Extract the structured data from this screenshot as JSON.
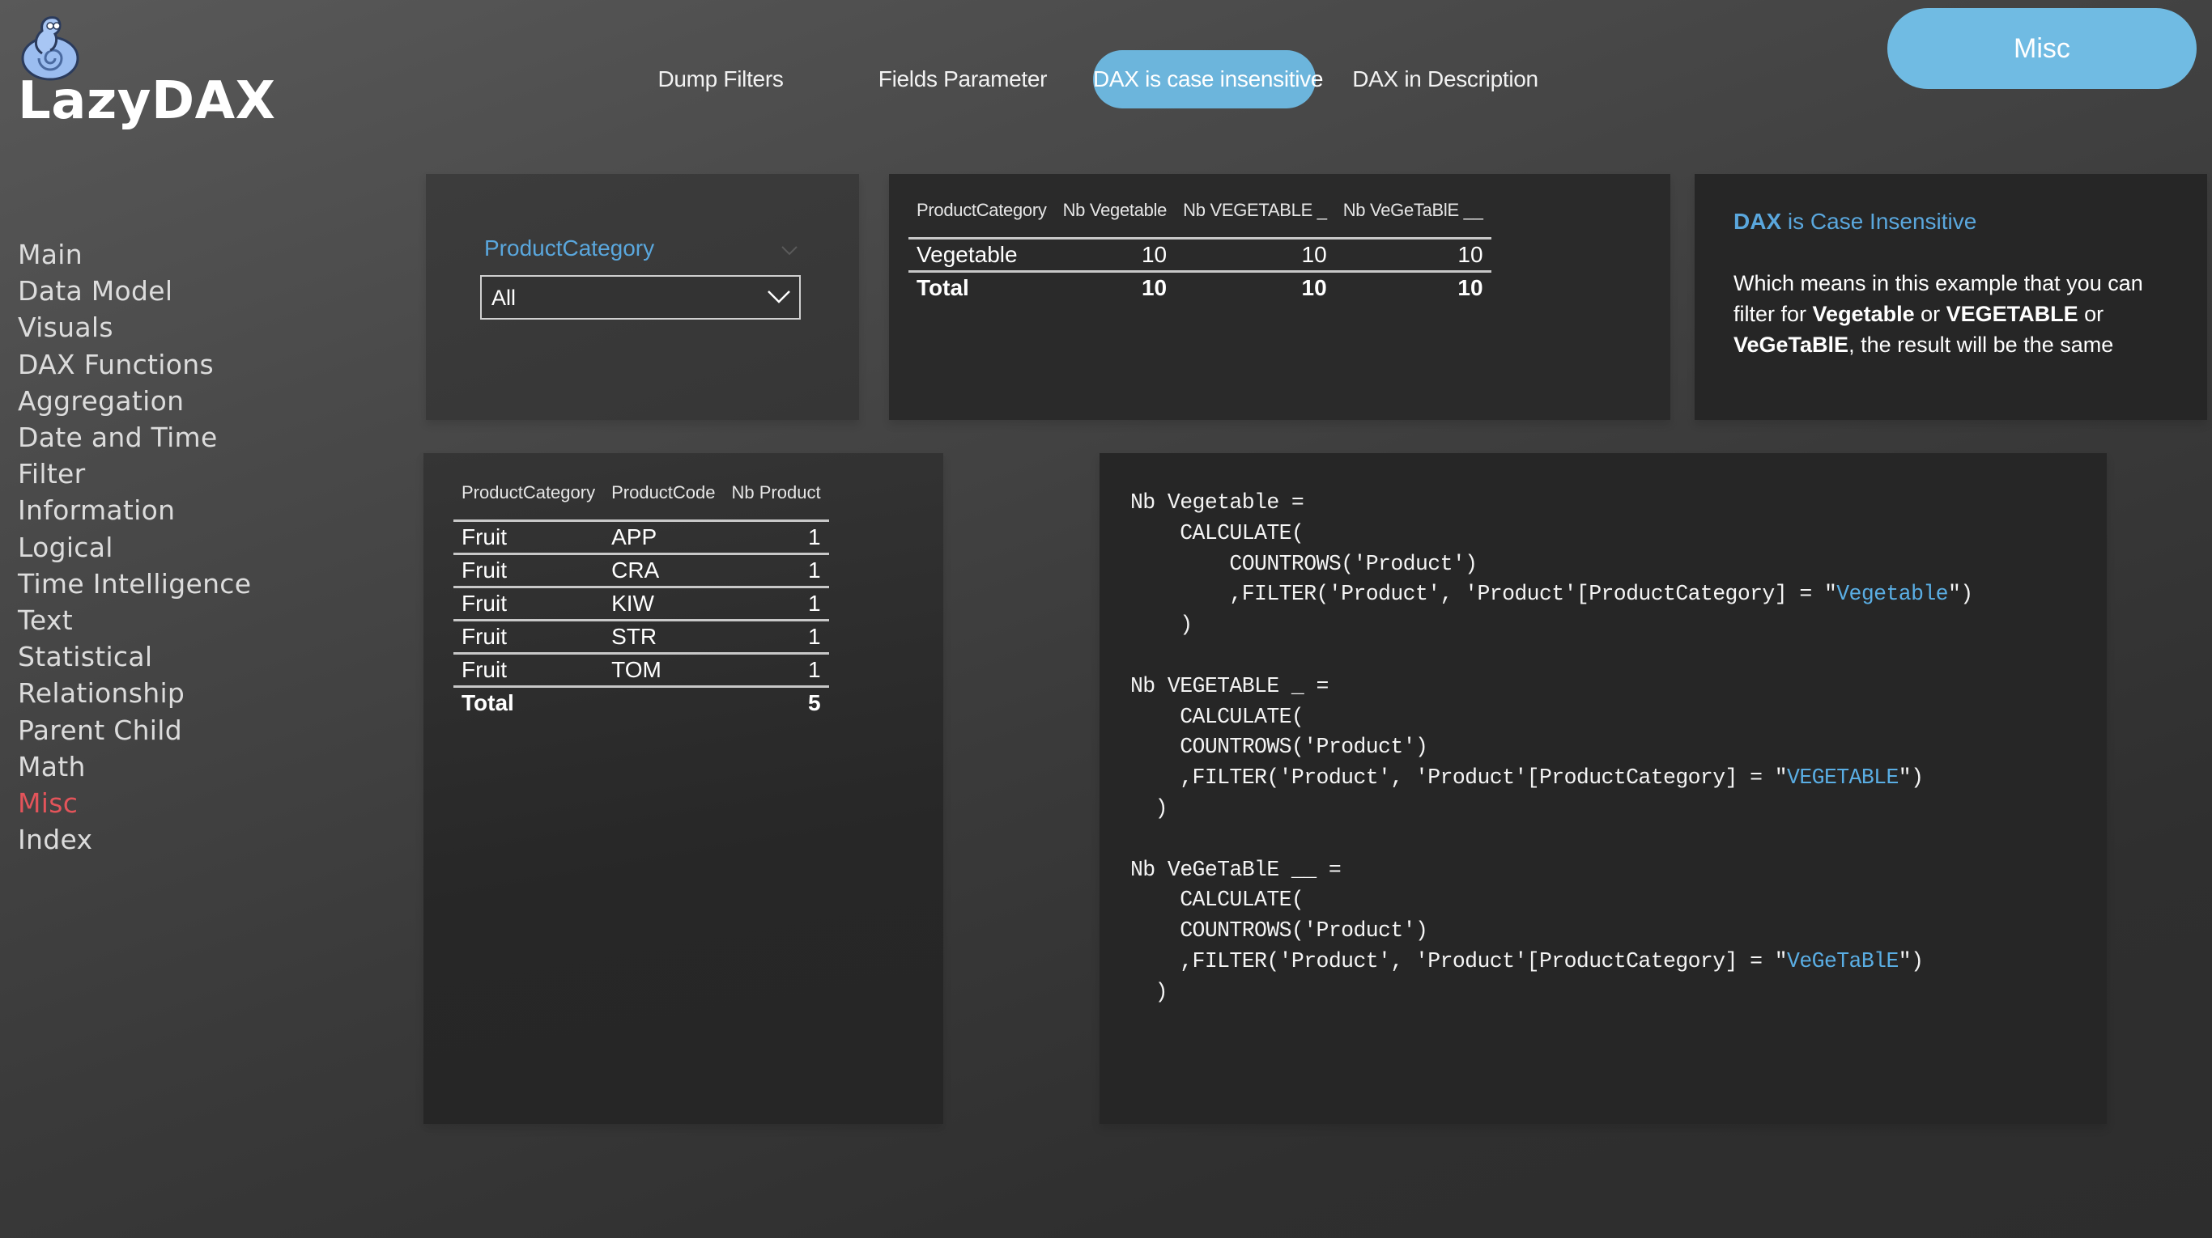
{
  "app": {
    "logo_text": "LazyDAX",
    "logo_icon": "snail-logo-icon"
  },
  "colors": {
    "accent_blue": "#6cb5dc",
    "title_blue": "#5aa7dd",
    "active_sidebar": "#e3545a",
    "code_string": "#5aaee4"
  },
  "top_nav": {
    "items": [
      {
        "label": "Dump Filters",
        "active": false
      },
      {
        "label": "Fields Parameter",
        "active": false
      },
      {
        "label": "DAX is case insensitive",
        "active": true
      },
      {
        "label": "DAX in Description",
        "active": false
      }
    ],
    "section_button": "Misc"
  },
  "sidebar": {
    "items": [
      {
        "label": "Main"
      },
      {
        "label": "Data Model"
      },
      {
        "label": "Visuals"
      },
      {
        "label": "DAX Functions"
      },
      {
        "label": "Aggregation"
      },
      {
        "label": "Date and Time"
      },
      {
        "label": "Filter"
      },
      {
        "label": "Information"
      },
      {
        "label": "Logical"
      },
      {
        "label": "Time Intelligence"
      },
      {
        "label": "Text"
      },
      {
        "label": "Statistical"
      },
      {
        "label": "Relationship"
      },
      {
        "label": "Parent Child"
      },
      {
        "label": "Math"
      },
      {
        "label": "Misc",
        "active": true
      },
      {
        "label": "Index"
      }
    ]
  },
  "slicer": {
    "title": "ProductCategory",
    "selected": "All"
  },
  "matrix": {
    "columns": [
      "ProductCategory",
      "Nb Vegetable",
      "Nb VEGETABLE _",
      "Nb VeGeTaBlE __"
    ],
    "rows": [
      [
        "Vegetable",
        "10",
        "10",
        "10"
      ]
    ],
    "total": [
      "Total",
      "10",
      "10",
      "10"
    ]
  },
  "note": {
    "title_bold": "DAX",
    "title_rest": " is Case Insensitive",
    "body_1": "Which means in this example that you can filter for ",
    "bold_1": "Vegetable",
    "body_2": " or ",
    "bold_2": "VEGETABLE",
    "body_3": " or ",
    "bold_3": "VeGeTaBlE",
    "body_4": ", the result will be the same"
  },
  "products_table": {
    "columns": [
      "ProductCategory",
      "ProductCode",
      "Nb Product"
    ],
    "rows": [
      [
        "Fruit",
        "APP",
        "1"
      ],
      [
        "Fruit",
        "CRA",
        "1"
      ],
      [
        "Fruit",
        "KIW",
        "1"
      ],
      [
        "Fruit",
        "STR",
        "1"
      ],
      [
        "Fruit",
        "TOM",
        "1"
      ]
    ],
    "total": [
      "Total",
      "",
      "5"
    ]
  },
  "code": {
    "lines": [
      {
        "text": "Nb Vegetable =",
        "str": ""
      },
      {
        "text": "    CALCULATE(",
        "str": ""
      },
      {
        "text": "        COUNTROWS('Product')",
        "str": ""
      },
      {
        "text": "        ,FILTER('Product', 'Product'[ProductCategory] = \"",
        "str": "Vegetable",
        "tail": "\")"
      },
      {
        "text": "    )",
        "str": ""
      },
      {
        "text": "",
        "str": ""
      },
      {
        "text": "Nb VEGETABLE _ =",
        "str": ""
      },
      {
        "text": "    CALCULATE(",
        "str": ""
      },
      {
        "text": "    COUNTROWS('Product')",
        "str": ""
      },
      {
        "text": "    ,FILTER('Product', 'Product'[ProductCategory] = \"",
        "str": "VEGETABLE",
        "tail": "\")"
      },
      {
        "text": "  )",
        "str": ""
      },
      {
        "text": "",
        "str": ""
      },
      {
        "text": "Nb VeGeTaBlE __ =",
        "str": ""
      },
      {
        "text": "    CALCULATE(",
        "str": ""
      },
      {
        "text": "    COUNTROWS('Product')",
        "str": ""
      },
      {
        "text": "    ,FILTER('Product', 'Product'[ProductCategory] = \"",
        "str": "VeGeTaBlE",
        "tail": "\")"
      },
      {
        "text": "  )",
        "str": ""
      }
    ]
  }
}
